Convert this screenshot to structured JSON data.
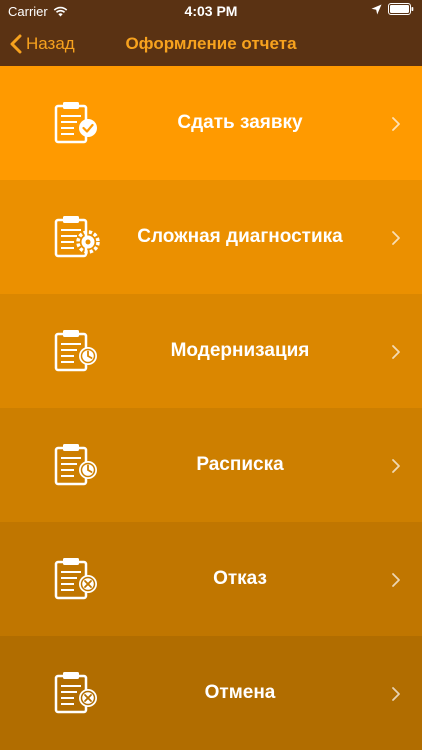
{
  "status_bar": {
    "carrier": "Carrier",
    "time": "4:03 PM",
    "icons": [
      "wifi-icon",
      "location-arrow-icon",
      "battery-icon"
    ]
  },
  "nav": {
    "back_label": "Назад",
    "title": "Оформление отчета",
    "accent_color": "#f7a21e",
    "background_color": "#5a3213"
  },
  "menu": {
    "items": [
      {
        "label": "Сдать заявку",
        "icon": "clipboard-check-icon",
        "color": "#ff9a00"
      },
      {
        "label": "Сложная диагностика",
        "icon": "clipboard-gear-icon",
        "color": "#eb9000"
      },
      {
        "label": "Модернизация",
        "icon": "clipboard-clock-icon",
        "color": "#db8700"
      },
      {
        "label": "Расписка",
        "icon": "clipboard-clock-icon",
        "color": "#cd7f00"
      },
      {
        "label": "Отказ",
        "icon": "clipboard-cross-icon",
        "color": "#c07600"
      },
      {
        "label": "Отмена",
        "icon": "clipboard-cross-icon",
        "color": "#b16d00"
      }
    ]
  }
}
